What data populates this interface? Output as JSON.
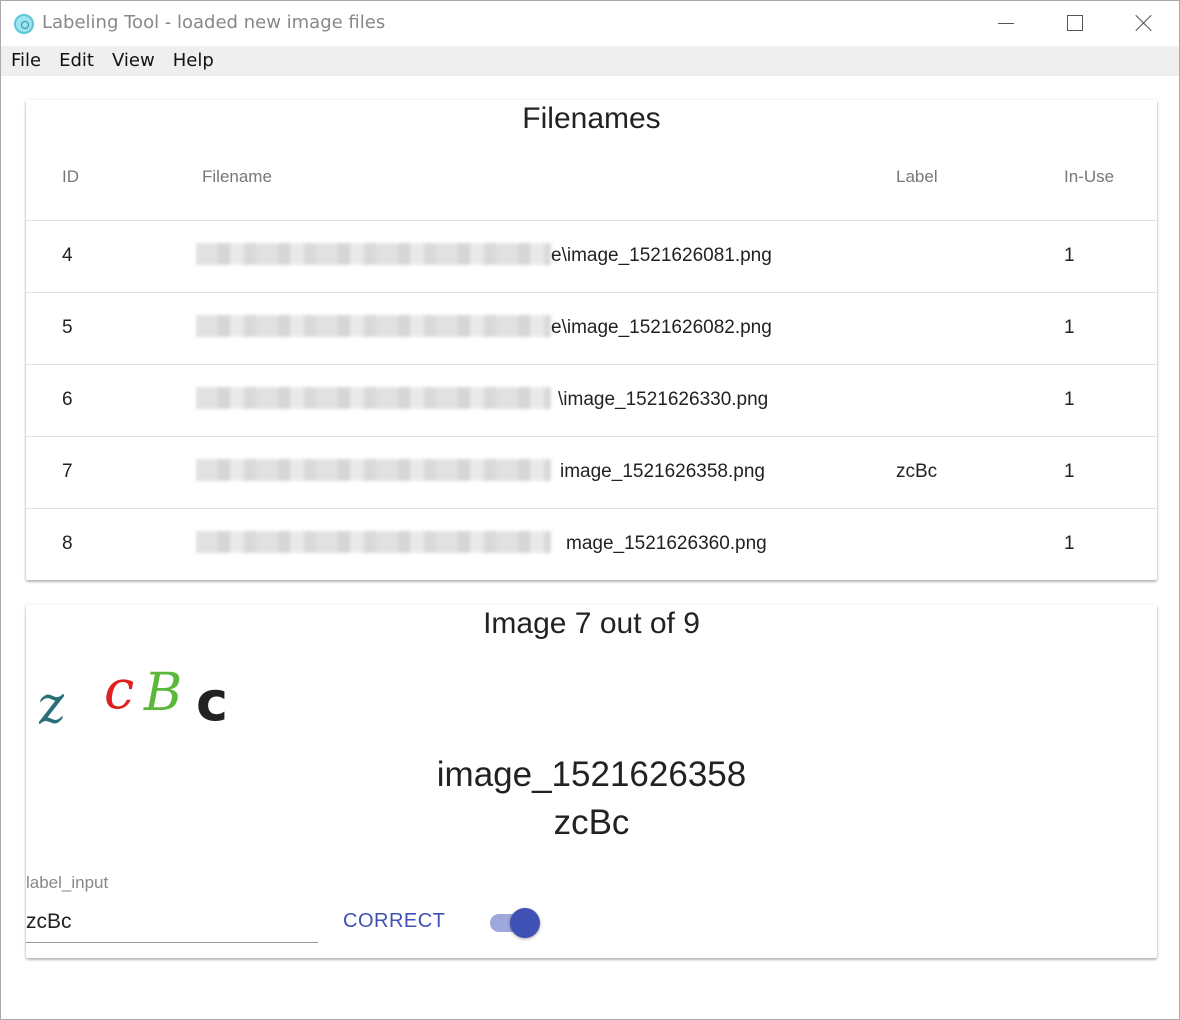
{
  "window": {
    "title": "Labeling Tool - loaded new image files"
  },
  "menu": {
    "items": [
      "File",
      "Edit",
      "View",
      "Help"
    ]
  },
  "filenames_table": {
    "title": "Filenames",
    "columns": {
      "id": "ID",
      "filename": "Filename",
      "label": "Label",
      "in_use": "In-Use"
    },
    "rows": [
      {
        "id": "4",
        "filename": "e\\image_1521626081.png",
        "label": "",
        "in_use": "1"
      },
      {
        "id": "5",
        "filename": "e\\image_1521626082.png",
        "label": "",
        "in_use": "1"
      },
      {
        "id": "6",
        "filename": "\\image_1521626330.png",
        "label": "",
        "in_use": "1"
      },
      {
        "id": "7",
        "filename": "image_1521626358.png",
        "label": "zcBc",
        "in_use": "1"
      },
      {
        "id": "8",
        "filename": "mage_1521626360.png",
        "label": "",
        "in_use": "1"
      }
    ]
  },
  "image_panel": {
    "title": "Image 7 out of 9",
    "image_name": "image_1521626358",
    "image_label": "zcBc",
    "captcha_text": "zcBc",
    "captcha_colors": [
      "#2a6f78",
      "#e02020",
      "#5cb83a",
      "#222222"
    ]
  },
  "label_form": {
    "input_label": "label_input",
    "input_value": "zcBc",
    "correct_button": "CORRECT",
    "toggle_on": true
  },
  "colors": {
    "accent": "#3f51b5",
    "accent_light": "#9fa8da"
  }
}
